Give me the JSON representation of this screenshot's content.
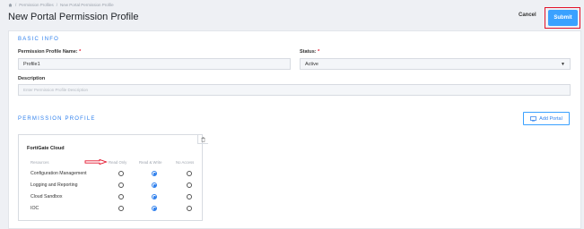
{
  "breadcrumb": {
    "items": [
      "Permission Profiles",
      "New Portal Permission Profile"
    ],
    "separator": "/"
  },
  "header": {
    "title": "New Portal Permission Profile",
    "cancel_label": "Cancel",
    "submit_label": "Submit"
  },
  "basic_info": {
    "section_title": "BASIC INFO",
    "name_label": "Permission Profile Name:",
    "name_value": "Profile1",
    "status_label": "Status:",
    "status_value": "Active",
    "required_mark": "*",
    "description_label": "Description",
    "description_placeholder": "Enter Permission Profile Description"
  },
  "permission_profile": {
    "section_title": "PERMISSION PROFILE",
    "add_portal_label": "Add Portal",
    "card": {
      "title": "FortiGate Cloud",
      "columns": [
        "Resources",
        "Read Only",
        "Read & Write",
        "No Access"
      ],
      "rows": [
        {
          "label": "Configuration Management",
          "selected": "Read & Write"
        },
        {
          "label": "Logging and Reporting",
          "selected": "Read & Write"
        },
        {
          "label": "Cloud Sandbox",
          "selected": "Read & Write"
        },
        {
          "label": "IOC",
          "selected": "Read & Write"
        }
      ]
    }
  },
  "colors": {
    "accent": "#2f80ed",
    "submit_bg": "#3aa1ff",
    "highlight": "#e3122a"
  }
}
